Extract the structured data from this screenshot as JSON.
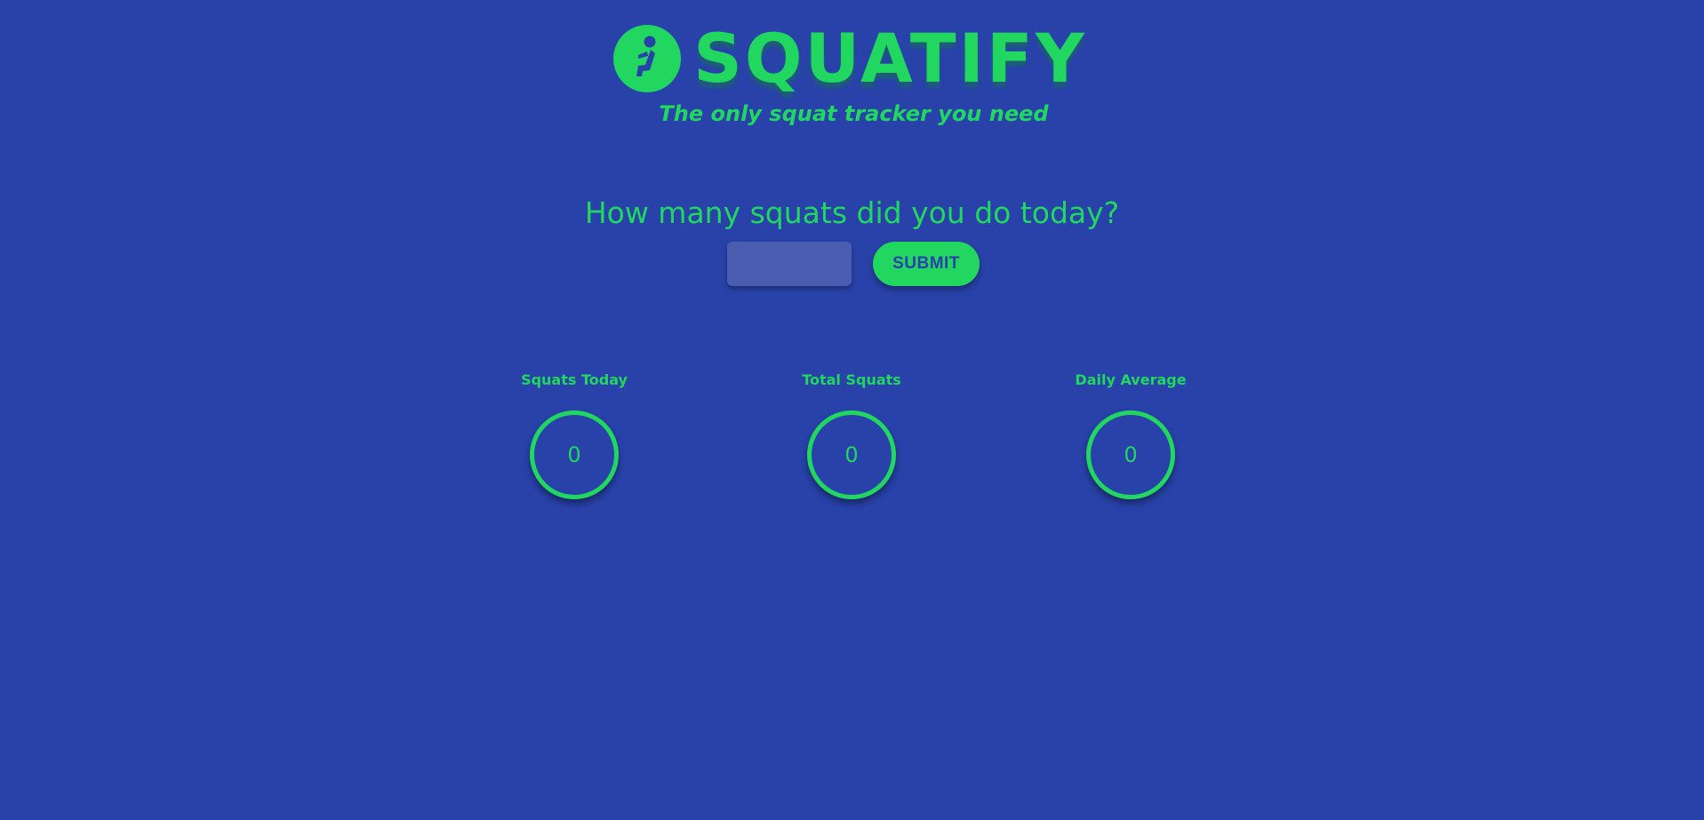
{
  "header": {
    "title": "SQUATIFY",
    "tagline": "The only squat tracker you need",
    "logo_icon": "squat-person-icon"
  },
  "form": {
    "question": "How many squats did you do today?",
    "input_value": "",
    "input_placeholder": "",
    "submit_label": "SUBMIT"
  },
  "stats": [
    {
      "label": "Squats Today",
      "value": "0"
    },
    {
      "label": "Total Squats",
      "value": "0"
    },
    {
      "label": "Daily Average",
      "value": "0"
    }
  ],
  "colors": {
    "background": "#2842aa",
    "accent": "#21d760",
    "input_background": "#4b5db1"
  }
}
